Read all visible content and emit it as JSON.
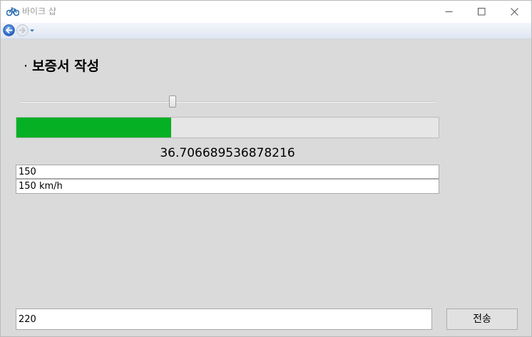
{
  "window": {
    "title": "바이크 샵",
    "icon": "bicycle-icon"
  },
  "navigation": {
    "back_icon": "back-arrow-icon",
    "forward_icon": "forward-arrow-icon",
    "dropdown_icon": "chevron-down-icon"
  },
  "form": {
    "bullet": "·",
    "heading": "보증서 작성",
    "slider_value_percent": 36.7,
    "progress_value_percent": 36.706689536878216,
    "progress_color": "#06b025",
    "value_label": "36.706689536878216",
    "textbox1_value": "150",
    "textbox2_value": "150 km/h"
  },
  "footer": {
    "textbox_value": "220",
    "send_label": "전송"
  }
}
